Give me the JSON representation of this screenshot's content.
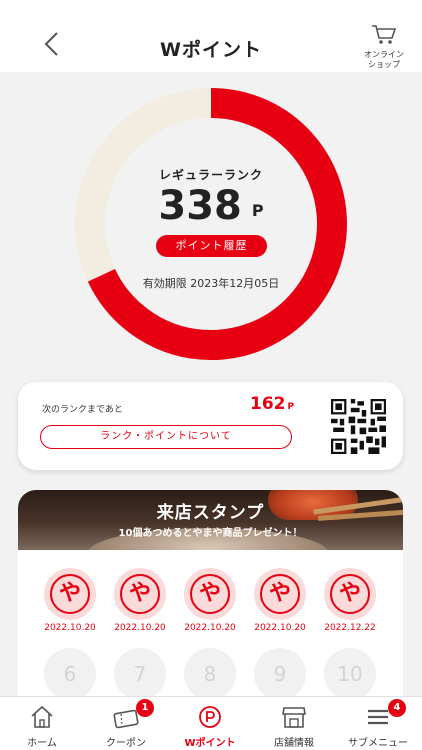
{
  "header": {
    "title": "Wポイント",
    "shop_label": "オンライン\nショップ"
  },
  "points": {
    "rank": "レギュラーランク",
    "value": "338",
    "unit": "P",
    "history_button": "ポイント履歴",
    "expiry": "有効期限 2023年12月05日",
    "progress_fraction": 0.68,
    "colors": {
      "filled": "#e60012",
      "remaining": "#f3ece1"
    }
  },
  "next_rank": {
    "label": "次のランクまであと",
    "value": "162",
    "unit": "P",
    "button": "ランク・ポイントについて"
  },
  "stamp_card": {
    "title": "来店スタンプ",
    "subtitle": "10個あつめるとやまや商品プレゼント！",
    "stamp_mark": "や",
    "stamps": [
      {
        "date": "2022.10.20"
      },
      {
        "date": "2022.10.20"
      },
      {
        "date": "2022.10.20"
      },
      {
        "date": "2022.10.20"
      },
      {
        "date": "2022.12.22"
      }
    ],
    "empty_slots": [
      "6",
      "7",
      "8",
      "9",
      "10"
    ]
  },
  "tabbar": {
    "items": [
      {
        "label": "ホーム",
        "icon": "home-icon"
      },
      {
        "label": "クーポン",
        "icon": "coupon-icon",
        "badge": "1"
      },
      {
        "label": "Wポイント",
        "icon": "point-icon",
        "active": true
      },
      {
        "label": "店舗情報",
        "icon": "store-icon"
      },
      {
        "label": "サブメニュー",
        "icon": "menu-icon",
        "badge": "4"
      }
    ]
  }
}
